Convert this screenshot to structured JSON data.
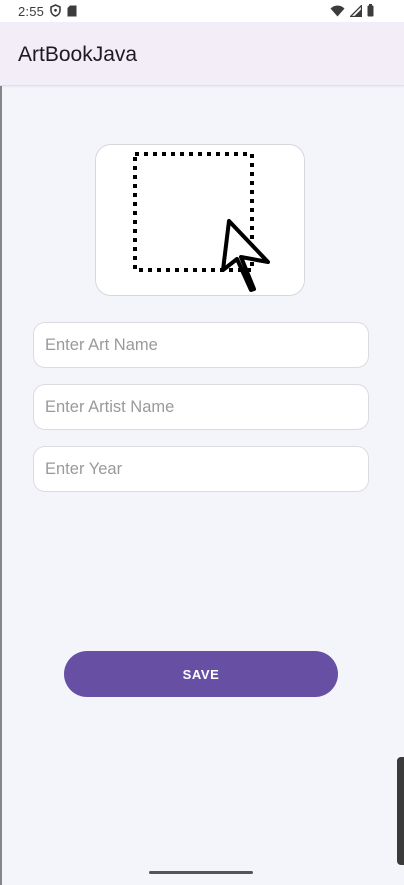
{
  "status_bar": {
    "time": "2:55",
    "left_icons": [
      "shield-icon",
      "sd-card-icon"
    ],
    "right_icons": [
      "wifi-icon",
      "signal-icon",
      "battery-icon"
    ]
  },
  "app_bar": {
    "title": "ArtBookJava"
  },
  "image_picker": {
    "icon": "select-image-cursor-icon"
  },
  "form": {
    "art_name_placeholder": "Enter Art Name",
    "artist_name_placeholder": "Enter Artist Name",
    "year_placeholder": "Enter Year"
  },
  "save_button": {
    "label": "SAVE"
  },
  "colors": {
    "primary": "#6750a4",
    "app_bar": "#f2edf7",
    "background": "#f4f5fa"
  }
}
